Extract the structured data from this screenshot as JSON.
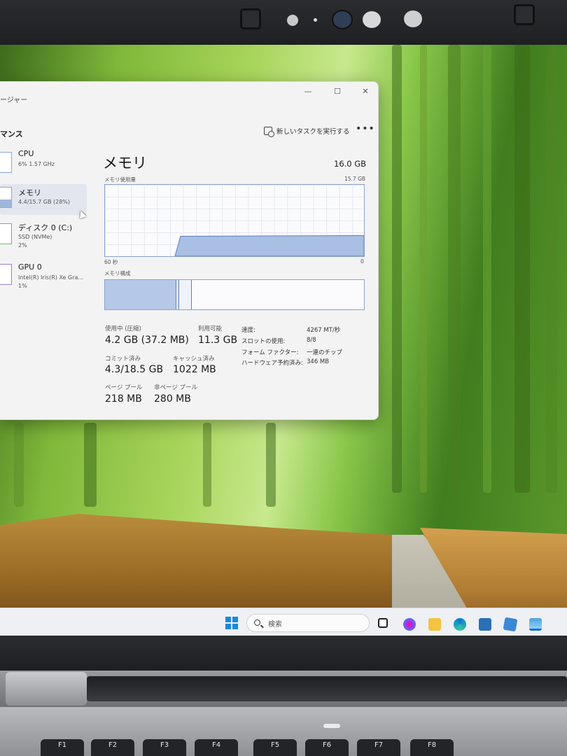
{
  "task_manager": {
    "window_title_fragment": "ージャー",
    "section_title_fragment": "マンス",
    "run_new_task_label": "新しいタスクを実行する",
    "more_label": "•••",
    "window_controls": {
      "minimize": "—",
      "maximize": "☐",
      "close": "✕"
    }
  },
  "sidebar": {
    "items": [
      {
        "name": "CPU",
        "sub1": "6%  1.57 GHz",
        "sub2": ""
      },
      {
        "name": "メモリ",
        "sub1": "4.4/15.7 GB (28%)",
        "sub2": ""
      },
      {
        "name": "ディスク 0 (C:)",
        "sub1": "SSD (NVMe)",
        "sub2": "2%"
      },
      {
        "name": "GPU 0",
        "sub1": "Intel(R) Iris(R) Xe Gra...",
        "sub2": "1%"
      }
    ]
  },
  "memory": {
    "title": "メモリ",
    "total": "16.0 GB",
    "usage_label": "メモリ使用量",
    "usage_max": "15.7 GB",
    "axis_left": "60 秒",
    "axis_right": "0",
    "usage_fraction": 0.28,
    "composition_label": "メモリ構成",
    "stats": {
      "in_use_label": "使用中 (圧縮)",
      "in_use_value": "4.2 GB (37.2 MB)",
      "available_label": "利用可能",
      "available_value": "11.3 GB",
      "committed_label": "コミット済み",
      "committed_value": "4.3/18.5 GB",
      "cached_label": "キャッシュ済み",
      "cached_value": "1022 MB",
      "paged_label": "ページ プール",
      "paged_value": "218 MB",
      "nonpaged_label": "非ページ プール",
      "nonpaged_value": "280 MB"
    },
    "details": {
      "speed_label": "速度:",
      "speed_value": "4267 MT/秒",
      "slots_label": "スロットの使用:",
      "slots_value": "8/8",
      "form_label": "フォーム ファクター:",
      "form_value": "一連のチップ",
      "reserved_label": "ハードウェア予約済み:",
      "reserved_value": "346 MB"
    }
  },
  "taskbar": {
    "search_placeholder": "検索"
  },
  "keyboard": {
    "keys": [
      "F1",
      "F2",
      "F3",
      "F4",
      "F5",
      "F6",
      "F7",
      "F8"
    ]
  },
  "colors": {
    "graph_fill": "#a9bfe3",
    "graph_stroke": "#5f7fb6",
    "composition_fill": "#b6c8e8"
  }
}
